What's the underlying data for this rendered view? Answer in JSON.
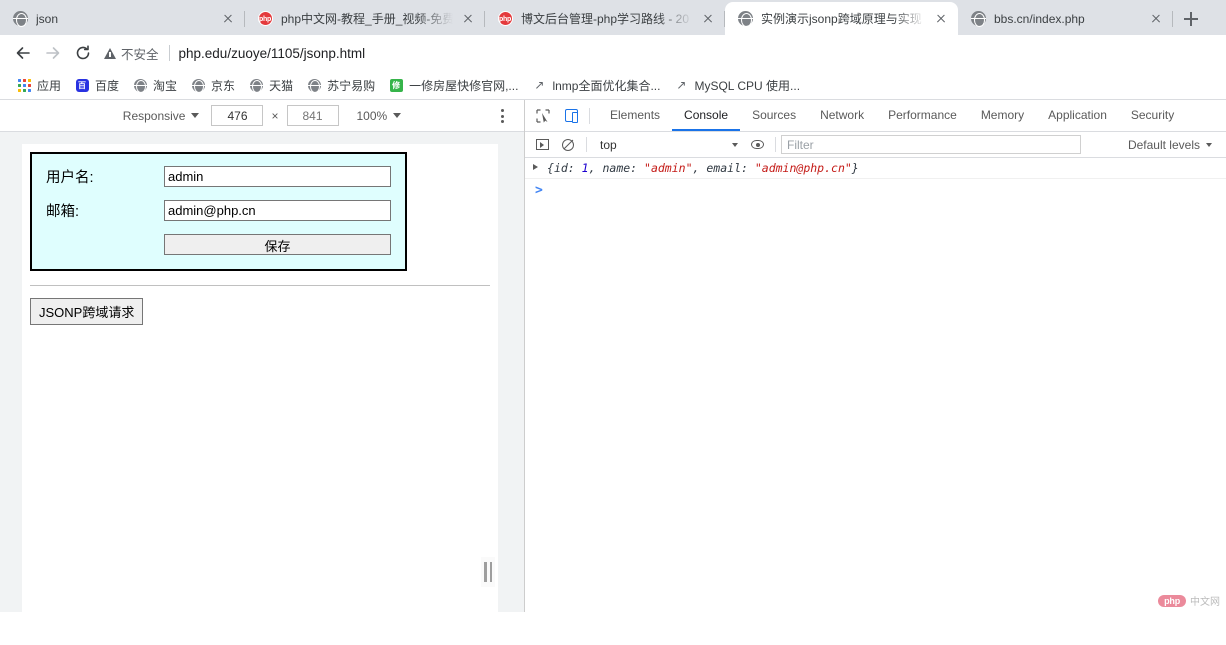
{
  "browser": {
    "tabs": [
      {
        "title": "json",
        "favicon": "globe-icon",
        "active": false
      },
      {
        "title": "php中文网-教程_手册_视频-免费",
        "favicon": "php-icon",
        "active": false
      },
      {
        "title": "博文后台管理-php学习路线 - 20",
        "favicon": "php-icon",
        "active": false
      },
      {
        "title": "实例演示jsonp跨域原理与实现",
        "favicon": "globe-icon",
        "active": true
      },
      {
        "title": "bbs.cn/index.php",
        "favicon": "globe-icon",
        "active": false
      }
    ],
    "new_tab_label": "+",
    "toolbar": {
      "back_label": "Back",
      "forward_label": "Forward",
      "reload_label": "Reload",
      "security_label": "不安全",
      "url": "php.edu/zuoye/1105/jsonp.html"
    },
    "bookmarks": [
      {
        "label": "应用",
        "icon": "apps-grid-icon"
      },
      {
        "label": "百度",
        "icon": "baidu-icon"
      },
      {
        "label": "淘宝",
        "icon": "globe-icon"
      },
      {
        "label": "京东",
        "icon": "globe-icon"
      },
      {
        "label": "天猫",
        "icon": "globe-icon"
      },
      {
        "label": "苏宁易购",
        "icon": "globe-icon"
      },
      {
        "label": "一修房屋快修官网,...",
        "icon": "green-house-icon"
      },
      {
        "label": "lnmp全面优化集合...",
        "icon": "bookmark-icon"
      },
      {
        "label": "MySQL CPU 使用...",
        "icon": "bookmark-icon"
      }
    ]
  },
  "device_toolbar": {
    "device_label": "Responsive",
    "width_value": "476",
    "multiply": "×",
    "height_placeholder": "841",
    "zoom_label": "100%",
    "more_label": "More options"
  },
  "page": {
    "form": {
      "fields": [
        {
          "label": "用户名:",
          "value": "admin",
          "name": "username"
        },
        {
          "label": "邮箱:",
          "value": "admin@php.cn",
          "name": "email"
        }
      ],
      "submit_label": "保存"
    },
    "jsonp_button_label": "JSONP跨域请求"
  },
  "devtools": {
    "inspect_label": "Inspect element",
    "device_toolbar_label": "Toggle device toolbar",
    "tabs": [
      {
        "label": "Elements",
        "active": false
      },
      {
        "label": "Console",
        "active": true
      },
      {
        "label": "Sources",
        "active": false
      },
      {
        "label": "Network",
        "active": false
      },
      {
        "label": "Performance",
        "active": false
      },
      {
        "label": "Memory",
        "active": false
      },
      {
        "label": "Application",
        "active": false
      },
      {
        "label": "Security",
        "active": false
      }
    ],
    "filterbar": {
      "execute_label": "Create live expression",
      "clear_label": "Clear console",
      "context": "top",
      "eye_label": "Live expressions",
      "filter_placeholder": "Filter",
      "levels_label": "Default levels"
    },
    "console": {
      "log": {
        "open_brace": "{",
        "key_id": "id:",
        "val_id": "1",
        "comma1": ",",
        "key_name": "name:",
        "val_name": "\"admin\"",
        "comma2": ",",
        "key_email": "email:",
        "val_email": "\"admin@php.cn\"",
        "close_brace": "}"
      },
      "prompt": ">"
    }
  },
  "watermark": {
    "php": "php",
    "cn": "中文网"
  },
  "colors": {
    "accent": "#1a73e8",
    "tabstrip": "#dee1e6",
    "form_bg": "#dffefe",
    "string_token": "#c41a16",
    "number_token": "#1c00cf"
  }
}
